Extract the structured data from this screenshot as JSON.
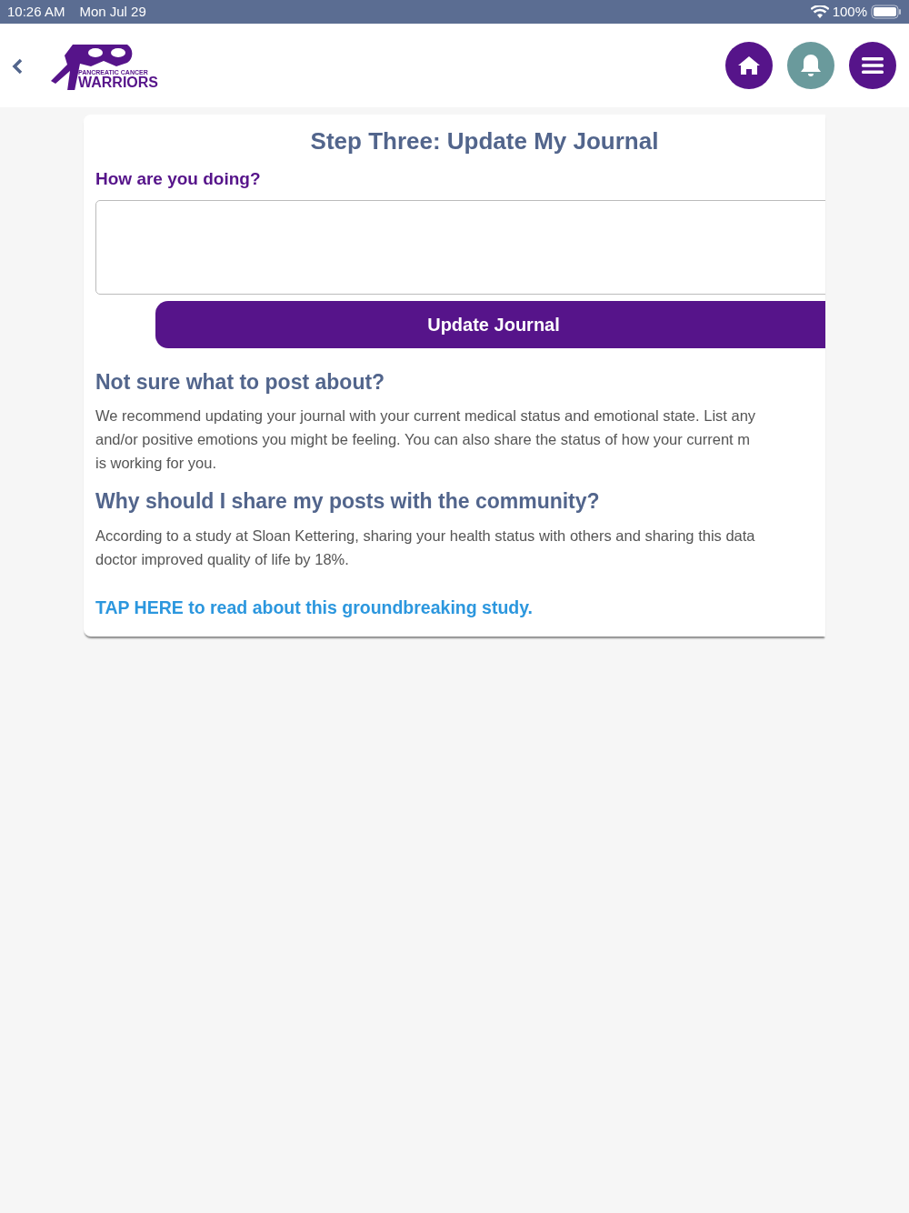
{
  "status_bar": {
    "time": "10:26 AM",
    "date": "Mon Jul 29",
    "battery": "100%"
  },
  "header": {
    "logo_lines": [
      "PANCREATIC CANCER",
      "WARRIORS"
    ]
  },
  "card": {
    "title": "Step Three: Update My Journal",
    "field_label": "How are you doing?",
    "button": "Update Journal",
    "sections": [
      {
        "heading": "Not sure what to post about?",
        "lines": [
          "We recommend updating your journal with your current medical status and emotional state. List any",
          "and/or positive emotions you might be feeling. You can also share the status of how your current m",
          "is working for you."
        ]
      },
      {
        "heading": "Why should I share my posts with the community?",
        "lines": [
          "According to a study at Sloan Kettering, sharing your health status with others and sharing this data",
          "doctor improved quality of life by 18%."
        ]
      }
    ],
    "link": "TAP HERE to read about this groundbreaking study."
  }
}
